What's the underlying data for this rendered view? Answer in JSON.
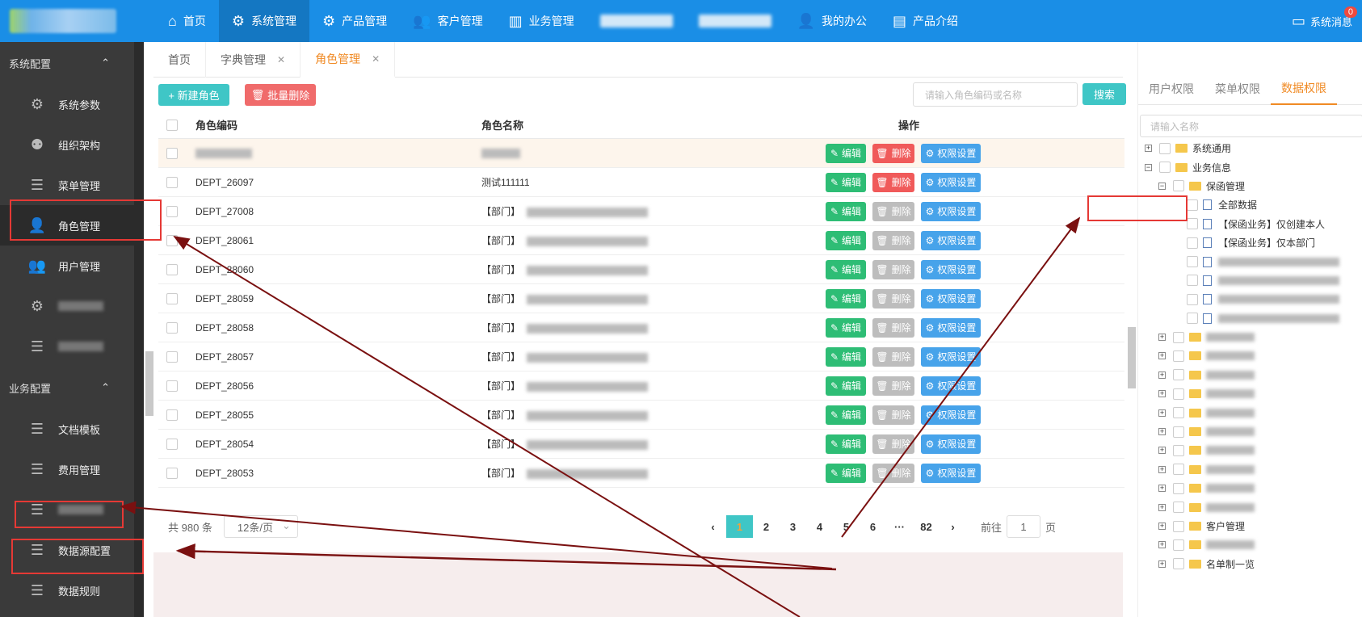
{
  "topbar": {
    "nav": [
      {
        "label": "首页",
        "icon": "home-icon"
      },
      {
        "label": "系统管理",
        "icon": "gear-icon"
      },
      {
        "label": "产品管理",
        "icon": "gear-icon"
      },
      {
        "label": "客户管理",
        "icon": "users-icon"
      },
      {
        "label": "业务管理",
        "icon": "bar-chart-icon"
      },
      {
        "label": "我的办公",
        "icon": "user-lock-icon"
      },
      {
        "label": "产品介绍",
        "icon": "document-icon"
      }
    ],
    "message_label": "系统消息",
    "message_badge": "0"
  },
  "sidebar": {
    "sections": [
      {
        "title": "系统配置",
        "items": [
          "系统参数",
          "组织架构",
          "菜单管理",
          "角色管理",
          "用户管理"
        ]
      },
      {
        "title": "业务配置",
        "items": [
          "文档模板",
          "费用管理",
          "数据源配置",
          "数据规则"
        ]
      }
    ],
    "active": "角色管理"
  },
  "tabs": [
    {
      "label": "首页"
    },
    {
      "label": "字典管理",
      "closable": true
    },
    {
      "label": "角色管理",
      "closable": true
    }
  ],
  "toolbar": {
    "new_label": "+ 新建角色",
    "delete_label": "批量删除",
    "search_placeholder": "请输入角色编码或名称",
    "search_label": "搜索"
  },
  "table": {
    "columns": [
      "角色编码",
      "角色名称",
      "操作"
    ],
    "buttons": {
      "edit": "编辑",
      "delete": "删除",
      "perm": "权限设置"
    },
    "rows": [
      {
        "code": "",
        "name": "",
        "dept": false,
        "deletable": true,
        "highlight": true
      },
      {
        "code": "DEPT_26097",
        "name": "测试111111",
        "dept": false,
        "deletable": true
      },
      {
        "code": "DEPT_27008",
        "name": "【部门】",
        "dept": true,
        "deletable": false
      },
      {
        "code": "DEPT_28061",
        "name": "【部门】",
        "dept": true,
        "deletable": false
      },
      {
        "code": "DEPT_28060",
        "name": "【部门】",
        "dept": true,
        "deletable": false
      },
      {
        "code": "DEPT_28059",
        "name": "【部门】",
        "dept": true,
        "deletable": false
      },
      {
        "code": "DEPT_28058",
        "name": "【部门】",
        "dept": true,
        "deletable": false
      },
      {
        "code": "DEPT_28057",
        "name": "【部门】",
        "dept": true,
        "deletable": false
      },
      {
        "code": "DEPT_28056",
        "name": "【部门】",
        "dept": true,
        "deletable": false
      },
      {
        "code": "DEPT_28055",
        "name": "【部门】",
        "dept": true,
        "deletable": false
      },
      {
        "code": "DEPT_28054",
        "name": "【部门】",
        "dept": true,
        "deletable": false
      },
      {
        "code": "DEPT_28053",
        "name": "【部门】",
        "dept": true,
        "deletable": false
      }
    ]
  },
  "pager": {
    "total": "共 980 条",
    "size": "12条/页",
    "pages": [
      "1",
      "2",
      "3",
      "4",
      "5",
      "6",
      "···",
      "82"
    ],
    "current": "1",
    "goto_prefix": "前往",
    "goto_value": "1",
    "goto_suffix": "页"
  },
  "right": {
    "tabs": [
      "用户权限",
      "菜单权限",
      "数据权限"
    ],
    "active_tab": "数据权限",
    "search_placeholder": "请输入名称",
    "tree": [
      {
        "label": "系统通用",
        "level": 0,
        "type": "folder",
        "exp": "+"
      },
      {
        "label": "业务信息",
        "level": 0,
        "type": "folder",
        "exp": "−"
      },
      {
        "label": "保函管理",
        "level": 1,
        "type": "folder",
        "exp": "−"
      },
      {
        "label": "全部数据",
        "level": 2,
        "type": "file"
      },
      {
        "label": "【保函业务】仅创建本人",
        "level": 2,
        "type": "file"
      },
      {
        "label": "【保函业务】仅本部门",
        "level": 2,
        "type": "file"
      },
      {
        "label": "",
        "level": 2,
        "type": "file"
      },
      {
        "label": "",
        "level": 2,
        "type": "file"
      },
      {
        "label": "",
        "level": 2,
        "type": "file"
      },
      {
        "label": "",
        "level": 2,
        "type": "file"
      },
      {
        "label": "",
        "level": 1,
        "type": "folder",
        "exp": "+"
      },
      {
        "label": "",
        "level": 1,
        "type": "folder",
        "exp": "+"
      },
      {
        "label": "",
        "level": 1,
        "type": "folder",
        "exp": "+"
      },
      {
        "label": "",
        "level": 1,
        "type": "folder",
        "exp": "+"
      },
      {
        "label": "",
        "level": 1,
        "type": "folder",
        "exp": "+"
      },
      {
        "label": "",
        "level": 1,
        "type": "folder",
        "exp": "+"
      },
      {
        "label": "",
        "level": 1,
        "type": "folder",
        "exp": "+"
      },
      {
        "label": "",
        "level": 1,
        "type": "folder",
        "exp": "+"
      },
      {
        "label": "",
        "level": 1,
        "type": "folder",
        "exp": "+"
      },
      {
        "label": "",
        "level": 1,
        "type": "folder",
        "exp": "+"
      },
      {
        "label": "客户管理",
        "level": 1,
        "type": "folder",
        "exp": "+"
      },
      {
        "label": "",
        "level": 1,
        "type": "folder",
        "exp": "+"
      },
      {
        "label": "名单制一览",
        "level": 1,
        "type": "folder",
        "exp": "+"
      }
    ]
  },
  "colors": {
    "primary": "#1a8ee6",
    "teal": "#3fc6c6",
    "orange": "#f08a24",
    "annotation": "#e53935",
    "arrow": "#7a1010"
  }
}
